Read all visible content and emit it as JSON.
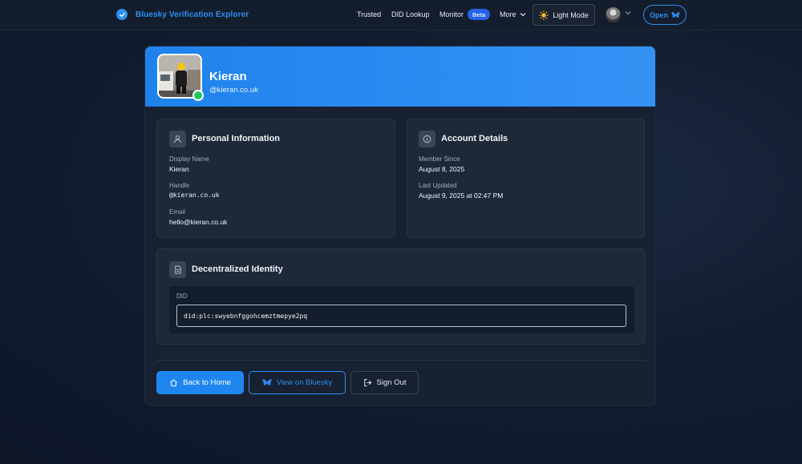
{
  "nav": {
    "brand": "Bluesky Verification Explorer",
    "links": [
      "Trusted",
      "DID Lookup",
      "Monitor"
    ],
    "beta_badge": "Beta",
    "more_label": "More",
    "theme_button": "Light Mode",
    "open_button": "Open"
  },
  "profile": {
    "name": "Kieran",
    "handle": "@kieran.co.uk"
  },
  "personal": {
    "title": "Personal Information",
    "display_name_label": "Display Name",
    "display_name": "Kieran",
    "handle_label": "Handle",
    "handle": "@kieran.co.uk",
    "email_label": "Email",
    "email": "hello@kieran.co.uk"
  },
  "account": {
    "title": "Account Details",
    "member_since_label": "Member Since",
    "member_since": "August 8, 2025",
    "last_updated_label": "Last Updated",
    "last_updated": "August 9, 2025 at 02:47 PM"
  },
  "identity": {
    "title": "Decentralized Identity",
    "did_label": "DID",
    "did": "did:plc:swyebnfggohcemztmepye2pq"
  },
  "actions": {
    "back": "Back to Home",
    "view": "View on Bluesky",
    "signout": "Sign Out"
  },
  "colors": {
    "accent": "#2b8ff2",
    "online": "#22c55e"
  }
}
